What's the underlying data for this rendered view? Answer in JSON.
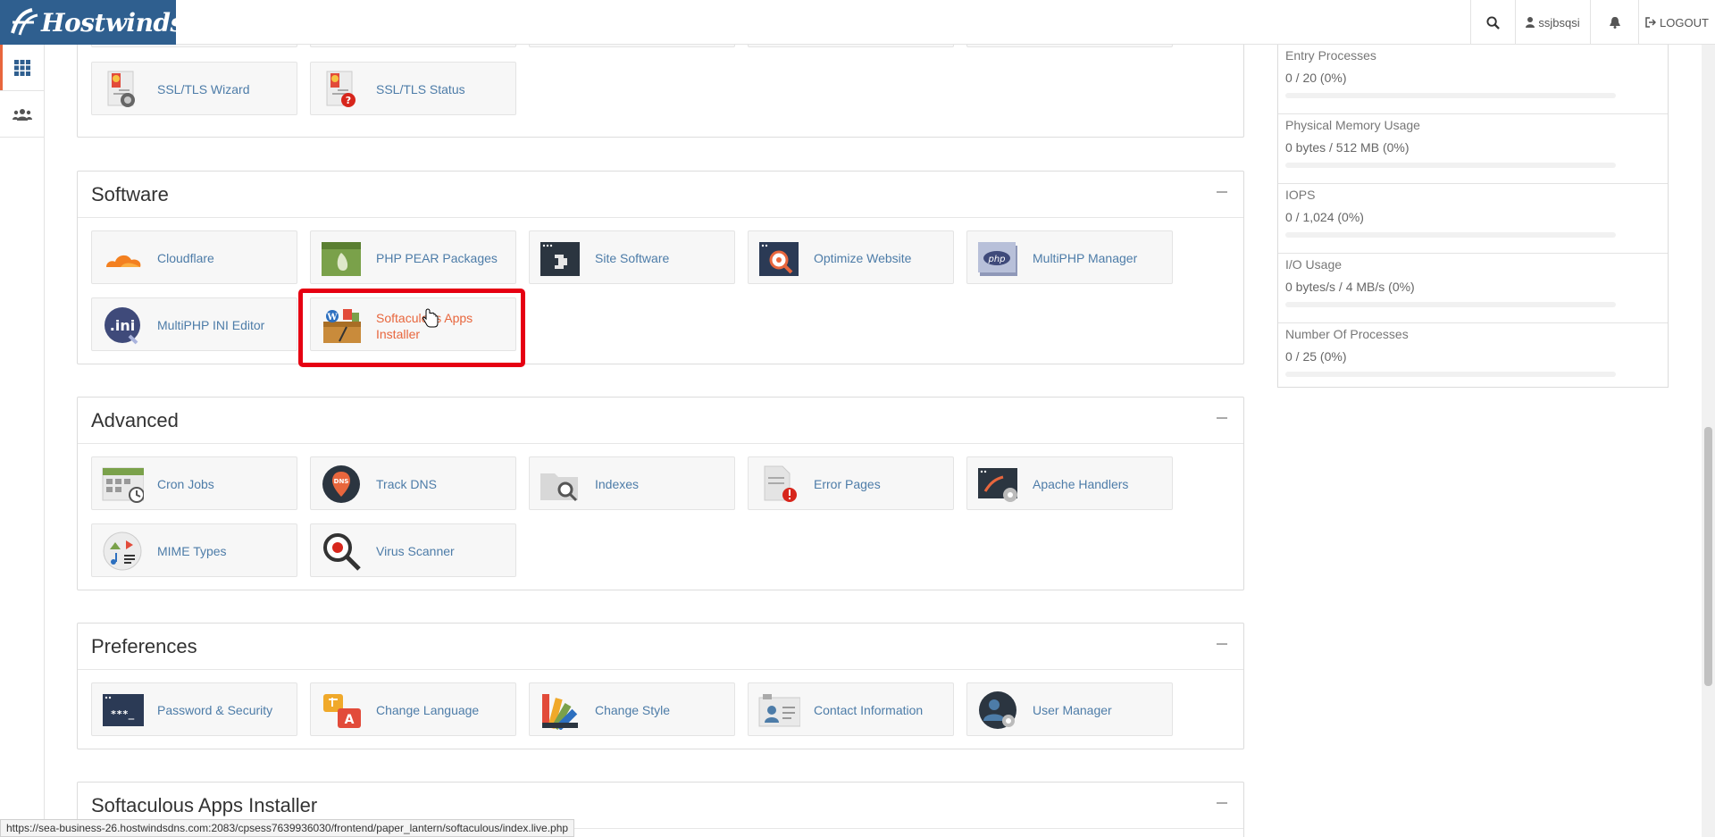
{
  "header": {
    "brand": "Hostwinds",
    "user_label": "ssjbsqsi",
    "logout_label": "LOGOUT"
  },
  "sections": {
    "security_row": [
      {
        "label": "SSL/TLS Wizard",
        "icon": "ssl-wizard-icon"
      },
      {
        "label": "SSL/TLS Status",
        "icon": "ssl-status-icon"
      }
    ],
    "software": {
      "title": "Software",
      "items": [
        {
          "label": "Cloudflare",
          "icon": "cloudflare-icon"
        },
        {
          "label": "PHP PEAR Packages",
          "icon": "php-pear-icon"
        },
        {
          "label": "Site Software",
          "icon": "site-software-icon"
        },
        {
          "label": "Optimize Website",
          "icon": "optimize-website-icon"
        },
        {
          "label": "MultiPHP Manager",
          "icon": "multiphp-manager-icon"
        },
        {
          "label": "MultiPHP INI Editor",
          "icon": "multiphp-ini-icon"
        },
        {
          "label": "Softaculous Apps Installer",
          "icon": "softaculous-icon"
        }
      ]
    },
    "advanced": {
      "title": "Advanced",
      "items": [
        {
          "label": "Cron Jobs",
          "icon": "cron-jobs-icon"
        },
        {
          "label": "Track DNS",
          "icon": "track-dns-icon"
        },
        {
          "label": "Indexes",
          "icon": "indexes-icon"
        },
        {
          "label": "Error Pages",
          "icon": "error-pages-icon"
        },
        {
          "label": "Apache Handlers",
          "icon": "apache-handlers-icon"
        },
        {
          "label": "MIME Types",
          "icon": "mime-types-icon"
        },
        {
          "label": "Virus Scanner",
          "icon": "virus-scanner-icon"
        }
      ]
    },
    "preferences": {
      "title": "Preferences",
      "items": [
        {
          "label": "Password & Security",
          "icon": "password-security-icon"
        },
        {
          "label": "Change Language",
          "icon": "change-language-icon"
        },
        {
          "label": "Change Style",
          "icon": "change-style-icon"
        },
        {
          "label": "Contact Information",
          "icon": "contact-information-icon"
        },
        {
          "label": "User Manager",
          "icon": "user-manager-icon"
        }
      ]
    },
    "softaculous": {
      "title": "Softaculous Apps Installer"
    }
  },
  "stats": [
    {
      "name": "Entry Processes",
      "value": "0 / 20   (0%)",
      "percent": 0
    },
    {
      "name": "Physical Memory Usage",
      "value": "0 bytes / 512 MB   (0%)",
      "percent": 0
    },
    {
      "name": "IOPS",
      "value": "0 / 1,024   (0%)",
      "percent": 0
    },
    {
      "name": "I/O Usage",
      "value": "0 bytes/s / 4 MB/s   (0%)",
      "percent": 0
    },
    {
      "name": "Number Of Processes",
      "value": "0 / 25   (0%)",
      "percent": 0
    }
  ],
  "status_url": "https://sea-business-26.hostwindsdns.com:2083/cpsess7639936030/frontend/paper_lantern/softaculous/index.live.php",
  "colors": {
    "link": "#4d7ca8",
    "hover_link": "#e8663d",
    "highlight": "#e60012",
    "brand_bg": "#2f5f8f"
  }
}
